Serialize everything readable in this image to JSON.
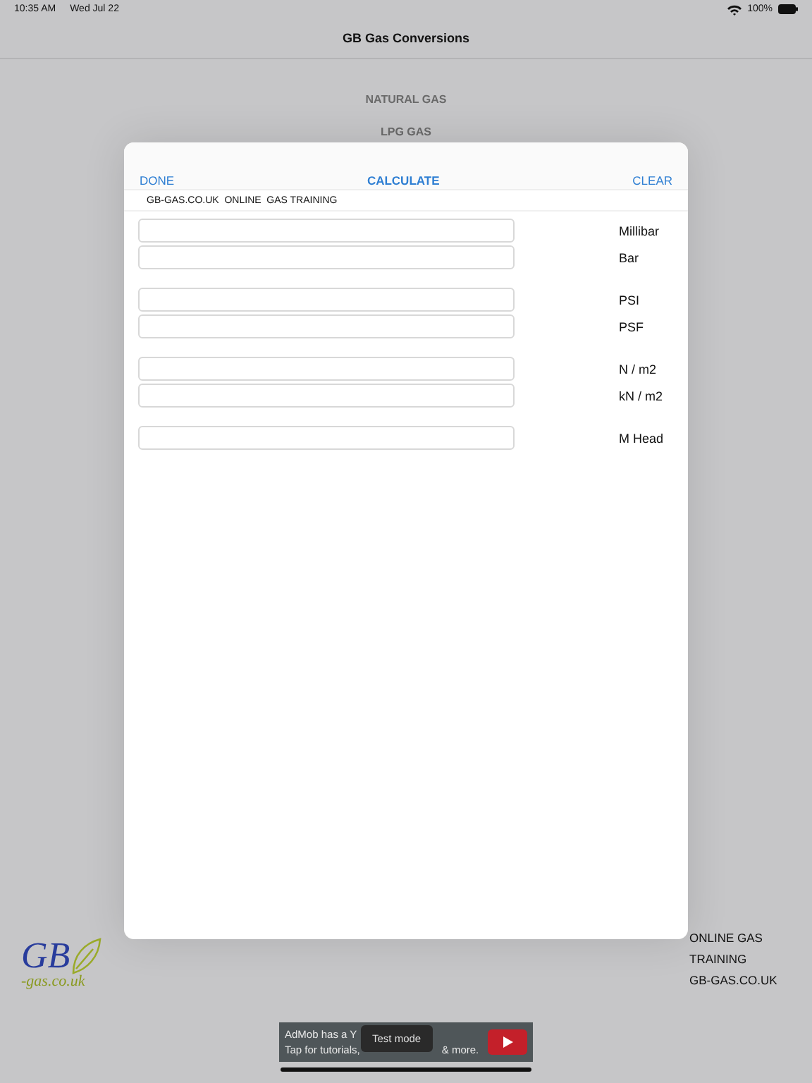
{
  "status_bar": {
    "time": "10:35 AM",
    "date": "Wed Jul 22",
    "battery": "100%"
  },
  "nav": {
    "title": "GB Gas Conversions"
  },
  "menu": [
    "NATURAL GAS",
    "LPG GAS"
  ],
  "modal": {
    "done": "DONE",
    "calculate": "CALCULATE",
    "clear": "CLEAR",
    "subtitle": "GB-GAS.CO.UK  ONLINE  GAS TRAINING",
    "groups": [
      [
        {
          "label": "Millibar"
        },
        {
          "label": "Bar"
        }
      ],
      [
        {
          "label": "PSI"
        },
        {
          "label": "PSF"
        }
      ],
      [
        {
          "label": "N / m2"
        },
        {
          "label": "kN / m2"
        }
      ],
      [
        {
          "label": "M Head"
        }
      ]
    ]
  },
  "footer": {
    "logo_main": "GB",
    "logo_sub": "-gas.co.uk",
    "lines": [
      "ONLINE GAS",
      "TRAINING",
      "GB-GAS.CO.UK"
    ]
  },
  "ad": {
    "line_1": "AdMob has a Y",
    "line_2_start": "Tap for tutorials,",
    "line_2_end": "& more.",
    "toast": "Test mode"
  }
}
